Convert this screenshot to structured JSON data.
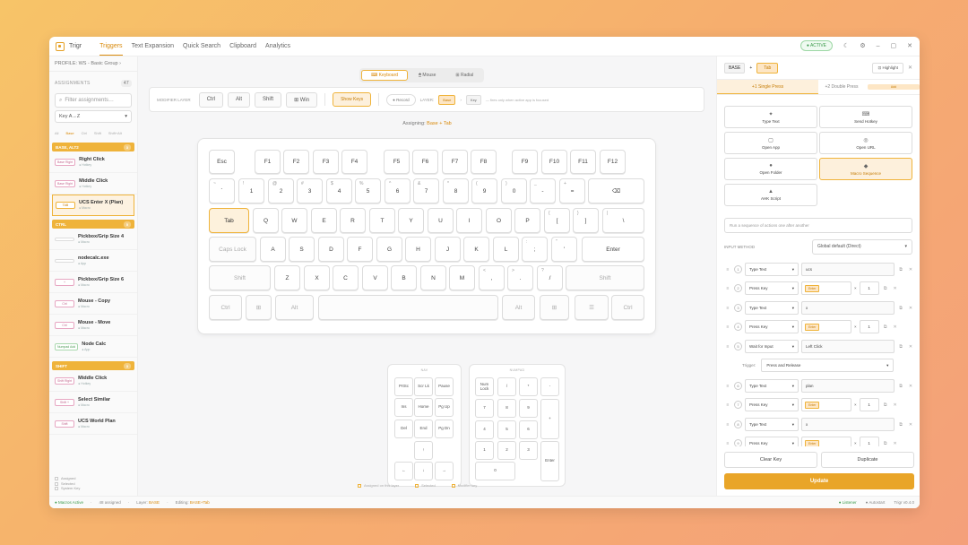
{
  "app": {
    "name": "Trigr"
  },
  "nav": [
    "Triggers",
    "Text Expansion",
    "Quick Search",
    "Clipboard",
    "Analytics"
  ],
  "active_label": "● ACTIVE",
  "sidebar": {
    "profile": "PROFILE: WS - Basic Group  ›",
    "assignments_label": "ASSIGNMENTS",
    "assignments_count": "47",
    "filter_placeholder": "Filter assignments…",
    "sort": "Key A→Z",
    "layer_tabs": [
      "All",
      "Base",
      "Ctrl",
      "Shift",
      "Shift+Alt"
    ],
    "groups": [
      {
        "name": "BASE, ALT2",
        "count": "3",
        "items": [
          {
            "chip": "Base Right",
            "title": "Right Click",
            "sub": "● Hotkey",
            "chip_style": "pink"
          },
          {
            "chip": "Base Right",
            "title": "Middle Click",
            "sub": "● Hotkey",
            "chip_style": "pink"
          },
          {
            "chip": "TAB",
            "title": "UCS Enter X (Plan)",
            "sub": "● Macro",
            "chip_style": "orange",
            "selected": true
          }
        ]
      },
      {
        "name": "CTRL",
        "count": "5",
        "items": [
          {
            "chip": "",
            "title": "Pickbox/Grip Size 4",
            "sub": "● Macro",
            "chip_style": "plain"
          },
          {
            "chip": "",
            "title": "nodecalc.exe",
            "sub": "● App",
            "chip_style": "plain"
          },
          {
            "chip": "+",
            "title": "Pickbox/Grip Size 6",
            "sub": "● Macro",
            "chip_style": "pink"
          },
          {
            "chip": "Ctrl",
            "title": "Mouse - Copy",
            "sub": "● Macro",
            "chip_style": "pink"
          },
          {
            "chip": "Ctrl",
            "title": "Mouse - Move",
            "sub": "● Macro",
            "chip_style": "pink"
          },
          {
            "chip": "Numpad Add",
            "title": "Node Calc",
            "sub": "● App",
            "chip_style": "green"
          }
        ]
      },
      {
        "name": "SHIFT",
        "count": "3",
        "items": [
          {
            "chip": "Shift Right",
            "title": "Middle Click",
            "sub": "● Hotkey",
            "chip_style": "pink"
          },
          {
            "chip": "Shift +",
            "title": "Select Similar",
            "sub": "● Macro",
            "chip_style": "pink"
          },
          {
            "chip": "Shift",
            "title": "UCS World Plan",
            "sub": "● Macro",
            "chip_style": "pink"
          }
        ]
      }
    ],
    "legend": [
      "Assigned",
      "Selected",
      "System Key"
    ]
  },
  "main": {
    "modes": [
      "⌨ Keyboard",
      "🖱 Mouse",
      "⊞ Radial"
    ],
    "modifier_label": "MODIFIER LAYER",
    "modifiers": [
      "Ctrl",
      "Alt",
      "Shift",
      "⊞ Win"
    ],
    "show_keys": "Show Keys",
    "record": "● Record",
    "layer_label": "LAYER:",
    "layer_base": "Base",
    "layer_sep": "›",
    "layer_key": "Key",
    "layer_hint": "— fires only when active app is focused",
    "assigning_label": "Assigning:",
    "assigning_value": "Base + Tab",
    "rows": [
      [
        "Esc",
        "F1",
        "F2",
        "F3",
        "F4",
        "F5",
        "F6",
        "F7",
        "F8",
        "F9",
        "F10",
        "F11",
        "F12"
      ],
      [
        "`",
        "1",
        "2",
        "3",
        "4",
        "5",
        "6",
        "7",
        "8",
        "9",
        "0",
        "-",
        "=",
        "⌫"
      ],
      [
        "Tab",
        "Q",
        "W",
        "E",
        "R",
        "T",
        "Y",
        "U",
        "I",
        "O",
        "P",
        "[",
        "]",
        "\\"
      ],
      [
        "Caps Lock",
        "A",
        "S",
        "D",
        "F",
        "G",
        "H",
        "J",
        "K",
        "L",
        ";",
        "'",
        "Enter"
      ],
      [
        "Shift",
        "Z",
        "X",
        "C",
        "V",
        "B",
        "N",
        "M",
        ",",
        ".",
        "/",
        "Shift"
      ],
      [
        "Ctrl",
        "⊞",
        "Alt",
        "",
        "Alt",
        "⊞",
        "☰",
        "Ctrl"
      ]
    ],
    "shifted": [
      "~",
      "!",
      "@",
      "#",
      "$",
      "%",
      "^",
      "&",
      "*",
      "(",
      ")",
      "_",
      "+",
      "",
      "{",
      "}",
      "|",
      ":",
      "\"",
      "<",
      ">",
      "?"
    ],
    "nav_title": "NAV",
    "nav_keys": [
      "PrtSc",
      "Scr Lk",
      "Pause",
      "Ins",
      "Home",
      "Pg Up",
      "Del",
      "End",
      "Pg Dn",
      "↑",
      "←",
      "↓",
      "→"
    ],
    "numpad_title": "NUMPAD",
    "numpad_keys": [
      "Num Lock",
      "/",
      "*",
      "-",
      "7",
      "8",
      "9",
      "+",
      "4",
      "5",
      "6",
      "1",
      "2",
      "3",
      "Enter",
      "0",
      "."
    ],
    "legend": [
      "Assigned on this layer",
      "Selected",
      "Modifier key"
    ]
  },
  "panel": {
    "layer": "BASE",
    "sep": "+",
    "key": "Tab",
    "highlight": "⊡ Highlight",
    "tabs": [
      "+1 Single Press",
      "+2 Double Press"
    ],
    "tab2_badge": "Add",
    "actions": [
      {
        "icon": "✦",
        "label": "Type Text"
      },
      {
        "icon": "⌨",
        "label": "Send Hotkey"
      },
      {
        "icon": "▢",
        "label": "Open App"
      },
      {
        "icon": "◎",
        "label": "Open URL"
      },
      {
        "icon": "●",
        "label": "Open Folder"
      },
      {
        "icon": "◆",
        "label": "Macro Sequence"
      },
      {
        "icon": "▲",
        "label": "AHK Script"
      }
    ],
    "description": "Run a sequence of actions one after another",
    "input_method_label": "INPUT METHOD",
    "input_method": "Global default (Direct)",
    "steps": [
      {
        "num": "1",
        "type": "Type Text",
        "value": "ucs"
      },
      {
        "num": "2",
        "type": "Press Key",
        "key": "Enter",
        "qty": "1"
      },
      {
        "num": "3",
        "type": "Type Text",
        "value": "x"
      },
      {
        "num": "4",
        "type": "Press Key",
        "key": "Enter",
        "qty": "1"
      },
      {
        "num": "5",
        "type": "Wait for Input",
        "value": "Left Click"
      },
      {
        "num": "6",
        "type": "Type Text",
        "value": "plan"
      },
      {
        "num": "7",
        "type": "Press Key",
        "key": "Enter",
        "qty": "1"
      },
      {
        "num": "8",
        "type": "Type Text",
        "value": "x"
      },
      {
        "num": "9",
        "type": "Press Key",
        "key": "Enter",
        "qty": "1"
      }
    ],
    "trigger_label": "Trigger:",
    "trigger_value": "Press and Release",
    "clear": "Clear Key",
    "duplicate": "Duplicate",
    "update": "Update"
  },
  "status": {
    "macros": "● Macros Active",
    "assigned": "48 assigned",
    "layer_prefix": "Layer:",
    "layer_value": "BASE",
    "editing_prefix": "Editing:",
    "editing_value": "BASE+Tab",
    "listener": "● Listener",
    "autostart": "● Autostart",
    "version": "Trigr v0.4.0"
  }
}
